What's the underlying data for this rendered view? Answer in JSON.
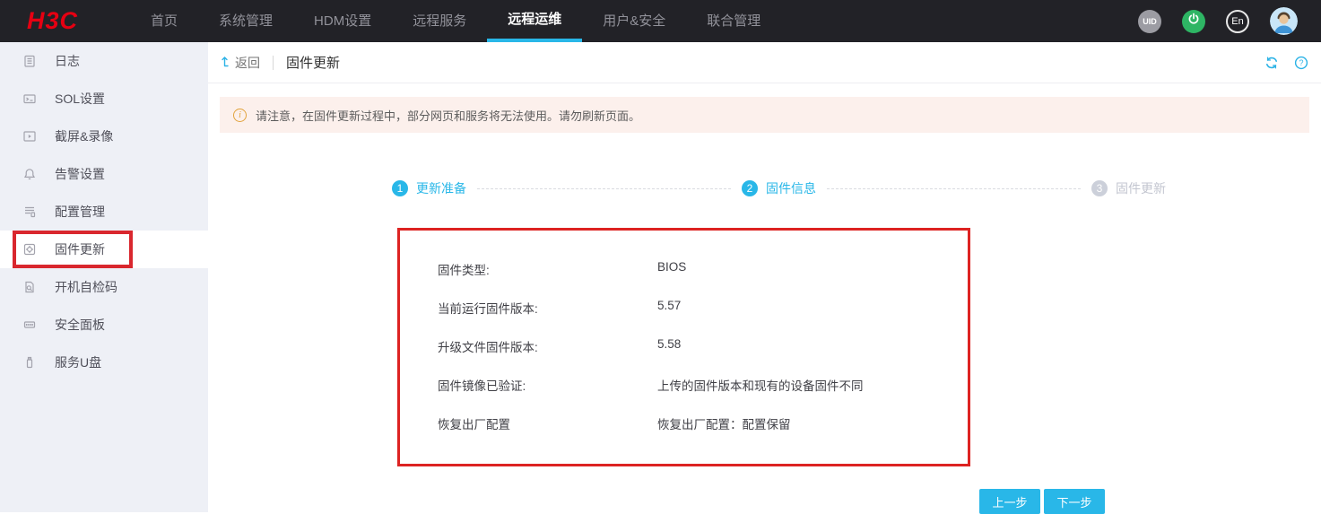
{
  "navbar": {
    "logo": "H3C",
    "tabs": [
      {
        "label": "首页",
        "active": false
      },
      {
        "label": "系统管理",
        "active": false
      },
      {
        "label": "HDM设置",
        "active": false
      },
      {
        "label": "远程服务",
        "active": false
      },
      {
        "label": "远程运维",
        "active": true
      },
      {
        "label": "用户&安全",
        "active": false
      },
      {
        "label": "联合管理",
        "active": false
      }
    ],
    "uid_badge": "UID",
    "lang_badge": "En",
    "icons": [
      "power-icon",
      "avatar"
    ]
  },
  "sidebar": {
    "items": [
      {
        "icon": "log-icon",
        "label": "日志",
        "selected": false
      },
      {
        "icon": "sol-icon",
        "label": "SOL设置",
        "selected": false
      },
      {
        "icon": "screen-record-icon",
        "label": "截屏&录像",
        "selected": false
      },
      {
        "icon": "alarm-icon",
        "label": "告警设置",
        "selected": false
      },
      {
        "icon": "config-icon",
        "label": "配置管理",
        "selected": false
      },
      {
        "icon": "firmware-icon",
        "label": "固件更新",
        "selected": true,
        "annotated": true
      },
      {
        "icon": "post-code-icon",
        "label": "开机自检码",
        "selected": false
      },
      {
        "icon": "security-panel-icon",
        "label": "安全面板",
        "selected": false
      },
      {
        "icon": "usb-icon",
        "label": "服务U盘",
        "selected": false
      }
    ]
  },
  "header": {
    "back_label": "返回",
    "title": "固件更新",
    "icons": [
      "refresh-icon",
      "help-icon"
    ]
  },
  "notice": {
    "text": "请注意，在固件更新过程中，部分网页和服务将无法使用。请勿刷新页面。"
  },
  "stepper": {
    "steps": [
      {
        "number": "1",
        "label": "更新准备",
        "state": "done"
      },
      {
        "number": "2",
        "label": "固件信息",
        "state": "active"
      },
      {
        "number": "3",
        "label": "固件更新",
        "state": "pending"
      }
    ]
  },
  "details": {
    "rows": [
      {
        "label": "固件类型:",
        "value": "BIOS"
      },
      {
        "label": "当前运行固件版本:",
        "value": "5.57"
      },
      {
        "label": "升级文件固件版本:",
        "value": "5.58"
      },
      {
        "label": "固件镜像已验证:",
        "value": "上传的固件版本和现有的设备固件不同"
      },
      {
        "label": "恢复出厂配置",
        "value": "恢复出厂配置：配置保留"
      }
    ]
  },
  "actions": {
    "prev_label": "上一步",
    "next_label": "下一步"
  },
  "colors": {
    "accent": "#29b7e8",
    "brand_red": "#e60012",
    "annotation_red": "#d9272e",
    "navbar_bg": "#222227",
    "sidebar_bg": "#eef0f6",
    "notice_bg": "#fcf0ec",
    "warning_icon": "#e2a33d",
    "power_green": "#2eb564"
  }
}
